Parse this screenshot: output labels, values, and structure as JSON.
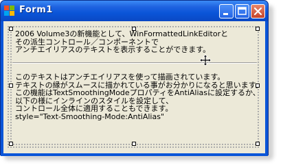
{
  "window": {
    "title": "Form1"
  },
  "content": {
    "text_block_1": [
      "2006 Volume3の新機能として、WinFormattedLinkEditorと",
      "その派生コントロール／コンポーネントで",
      "アンチエイリアスのテキストを表示することができます。"
    ],
    "text_block_2": [
      "このテキストはアンチエイリアスを使って描画されています。",
      "テキストの縁がスムースに描かれている事がお分かりになると思います。",
      "この機能はTextSmoothingModeプロパティをAntiAliasに設定するか、",
      "以下の様にインラインのスタイルを設定して、",
      "コントロール全体に適用することもできます。",
      "style=\"Text-Smoothing-Mode:AntiAlias\""
    ]
  },
  "icons": {
    "app": "windows-form-icon",
    "minimize": "minimize-icon",
    "maximize": "maximize-icon",
    "close": "close-icon",
    "move": "move-arrows-icon"
  },
  "colors": {
    "titlebar": "#0a55d8",
    "client": "#ece9d8",
    "close_button": "#c6452a"
  }
}
